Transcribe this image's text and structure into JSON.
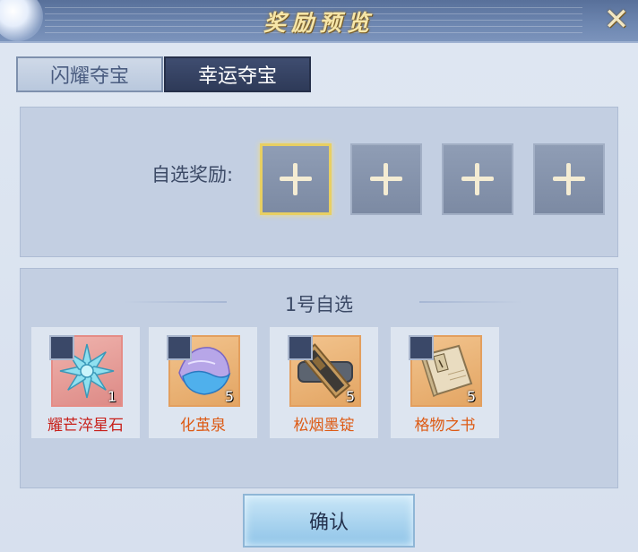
{
  "title": "奖励预览",
  "close_icon": "close-icon",
  "tabs": [
    {
      "label": "闪耀夺宝",
      "active": false
    },
    {
      "label": "幸运夺宝",
      "active": true
    }
  ],
  "selection": {
    "label": "自选奖励:",
    "slots": [
      {
        "icon": "plus-icon",
        "selected": true
      },
      {
        "icon": "plus-icon",
        "selected": false
      },
      {
        "icon": "plus-icon",
        "selected": false
      },
      {
        "icon": "plus-icon",
        "selected": false
      }
    ]
  },
  "section_title": "1号自选",
  "items": [
    {
      "name": "耀芒淬星石",
      "count": "1",
      "rarity_color": "#c8201a",
      "icon": "ice-crystal-icon"
    },
    {
      "name": "化茧泉",
      "count": "5",
      "rarity_color": "#dd5a14",
      "icon": "shell-water-icon"
    },
    {
      "name": "松烟墨锭",
      "count": "5",
      "rarity_color": "#dd5a14",
      "icon": "ink-stick-icon"
    },
    {
      "name": "格物之书",
      "count": "5",
      "rarity_color": "#dd5a14",
      "icon": "book-icon"
    }
  ],
  "confirm_label": "确认",
  "colors": {
    "accent_gold": "#e8cf62",
    "tab_active": "#2e3a58"
  }
}
